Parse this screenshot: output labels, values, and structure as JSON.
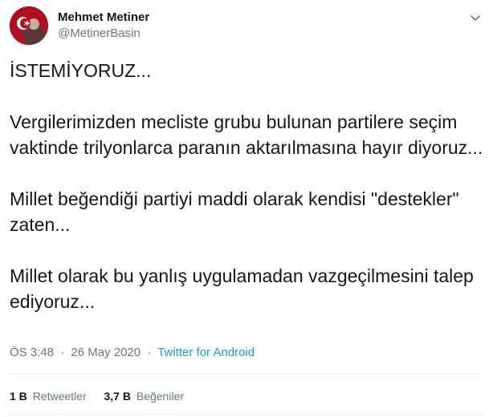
{
  "author": {
    "display_name": "Mehmet Metiner",
    "handle": "@MetinerBasin"
  },
  "tweet": {
    "text": "İSTEMİYORUZ...\n\nVergilerimizden mecliste grubu bulunan partilere seçim vaktinde trilyonlarca paranın aktarılmasına hayır diyoruz...\n\nMillet beğendiği partiyi maddi olarak kendisi \"destekler\" zaten...\n\nMillet olarak bu yanlış uygulamadan vazgeçilmesini talep ediyoruz..."
  },
  "meta": {
    "time": "ÖS 3:48",
    "separator": "·",
    "date": "26 May 2020",
    "source": "Twitter for Android"
  },
  "stats": {
    "retweets_count": "1 B",
    "retweets_label": "Retweetler",
    "likes_count": "3,7 B",
    "likes_label": "Beğeniler"
  },
  "icons": {
    "menu": "chevron-down-icon"
  },
  "colors": {
    "link": "#1b95e0",
    "secondary_text": "#657786",
    "avatar_flag": "#c8102e"
  }
}
